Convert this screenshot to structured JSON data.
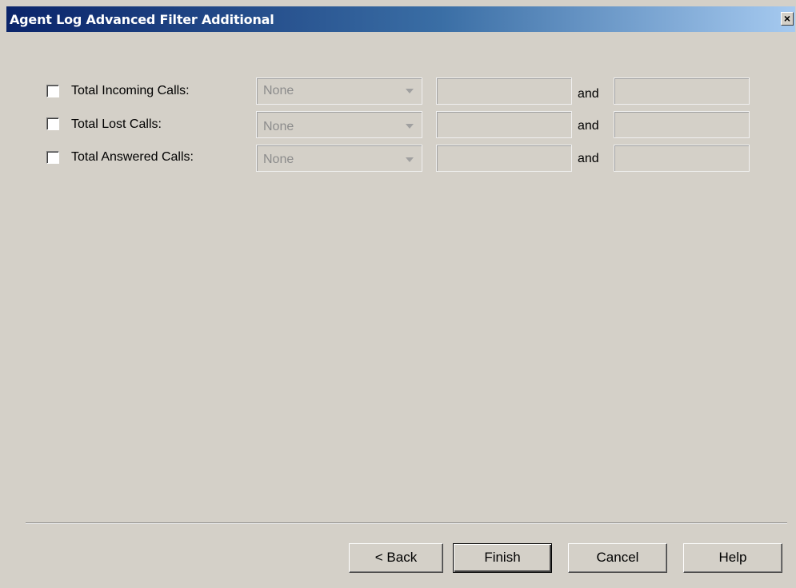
{
  "window": {
    "title": "Agent Log Advanced Filter Additional",
    "close_glyph": "×"
  },
  "rows": [
    {
      "label": "Total Incoming Calls:",
      "operator": "None",
      "conjunction": "and",
      "value_from": "",
      "value_to": ""
    },
    {
      "label": "Total Lost Calls:",
      "operator": "None",
      "conjunction": "and",
      "value_from": "",
      "value_to": ""
    },
    {
      "label": "Total Answered Calls:",
      "operator": "None",
      "conjunction": "and",
      "value_from": "",
      "value_to": ""
    }
  ],
  "buttons": {
    "back": "< Back",
    "finish": "Finish",
    "cancel": "Cancel",
    "help": "Help"
  }
}
